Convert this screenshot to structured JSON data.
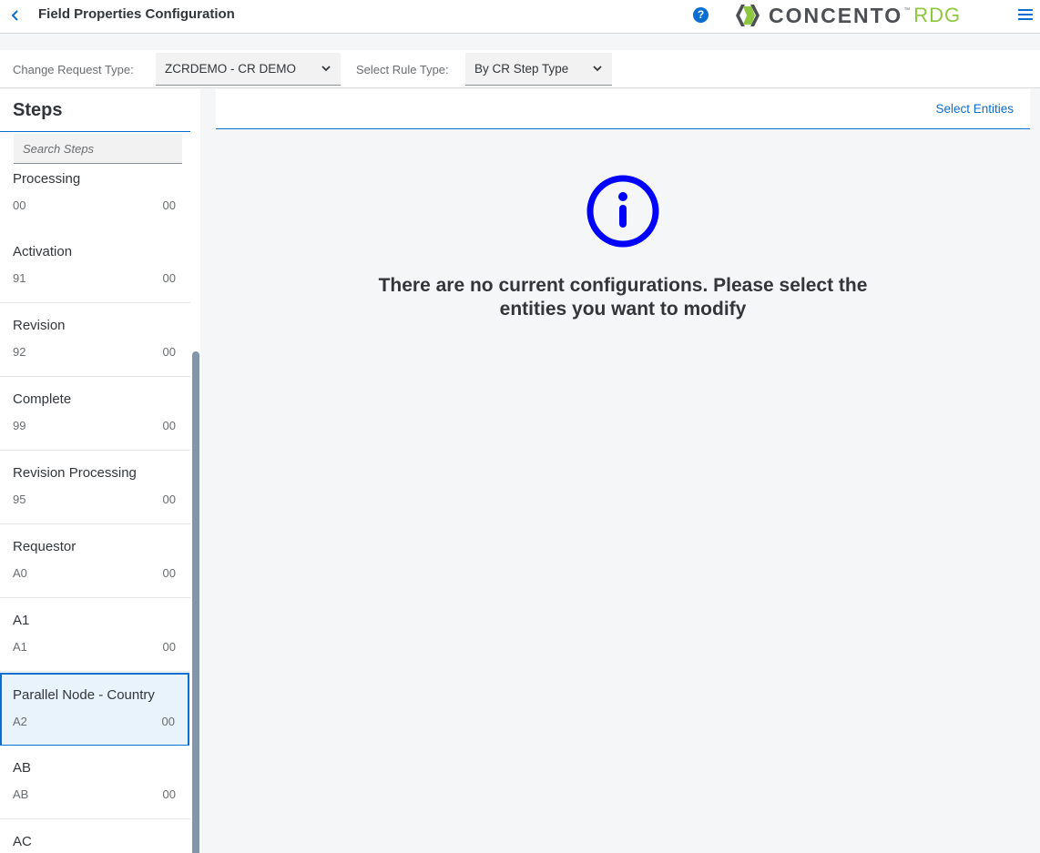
{
  "header": {
    "title": "Field Properties Configuration",
    "help_icon": "?",
    "logo_text": "CONCENTO",
    "logo_tm": "™",
    "logo_suffix": "RDG"
  },
  "filters": {
    "change_request_type_label": "Change Request Type:",
    "change_request_type_value": "ZCRDEMO - CR DEMO",
    "rule_type_label": "Select Rule Type:",
    "rule_type_value": "By CR Step Type"
  },
  "steps": {
    "title": "Steps",
    "search_placeholder": "Search Steps",
    "items": [
      {
        "name": "Processing",
        "code": "00",
        "value": "00"
      },
      {
        "name": "Activation",
        "code": "91",
        "value": "00"
      },
      {
        "name": "Revision",
        "code": "92",
        "value": "00"
      },
      {
        "name": "Complete",
        "code": "99",
        "value": "00"
      },
      {
        "name": "Revision Processing",
        "code": "95",
        "value": "00"
      },
      {
        "name": "Requestor",
        "code": "A0",
        "value": "00"
      },
      {
        "name": "A1",
        "code": "A1",
        "value": "00"
      },
      {
        "name": "Parallel Node - Country",
        "code": "A2",
        "value": "00",
        "selected": true
      },
      {
        "name": "AB",
        "code": "AB",
        "value": "00"
      },
      {
        "name": "AC",
        "code": "",
        "value": ""
      }
    ]
  },
  "detail": {
    "select_entities_label": "Select Entities",
    "empty_line1": "There are no current configurations. Please select the",
    "empty_line2": "entities you want to modify"
  },
  "colors": {
    "accent": "#0a6ed1",
    "info_icon": "#0000ff",
    "logo_green": "#8dc63f"
  }
}
